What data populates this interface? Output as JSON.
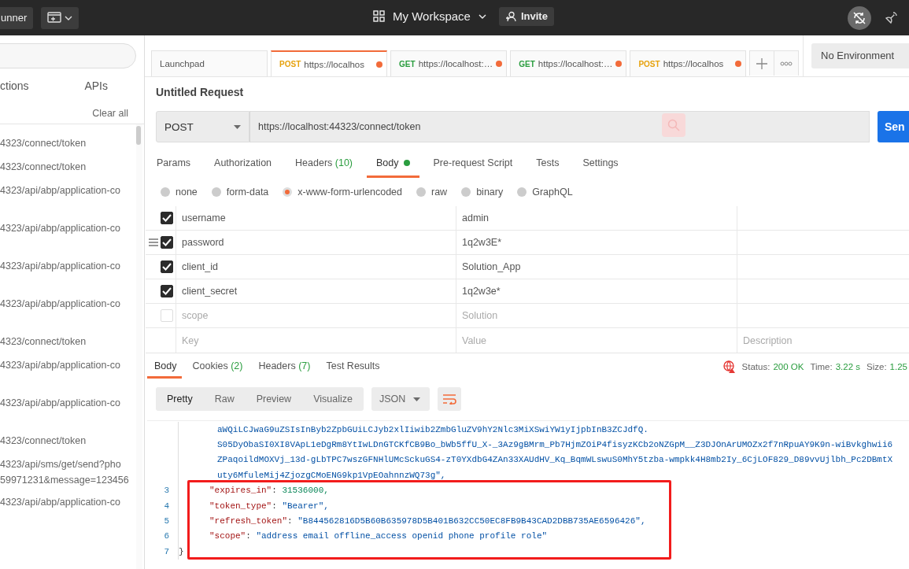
{
  "top_bar": {
    "runner": "unner",
    "workspace": "My Workspace",
    "invite": "Invite"
  },
  "sidebar": {
    "tabs": [
      "ctions",
      "APIs"
    ],
    "clear_all": "Clear all",
    "history": [
      {
        "lines": [
          "4323/connect/token"
        ],
        "tall": false
      },
      {
        "lines": [
          "4323/connect/token"
        ],
        "tall": false
      },
      {
        "lines": [
          "4323/api/abp/application-co"
        ],
        "tall": true
      },
      {
        "lines": [
          "4323/api/abp/application-co"
        ],
        "tall": true
      },
      {
        "lines": [
          "4323/api/abp/application-co"
        ],
        "tall": true
      },
      {
        "lines": [
          "4323/api/abp/application-co"
        ],
        "tall": true
      },
      {
        "lines": [
          "4323/connect/token"
        ],
        "tall": false
      },
      {
        "lines": [
          "4323/api/abp/application-co"
        ],
        "tall": true
      },
      {
        "lines": [
          "4323/api/abp/application-co"
        ],
        "tall": true
      },
      {
        "lines": [
          "4323/connect/token"
        ],
        "tall": false
      },
      {
        "lines": [
          "4323/api/sms/get/send?pho",
          "59971231&message=123456"
        ],
        "tall": true
      },
      {
        "lines": [
          "4323/api/abp/application-co"
        ],
        "tall": true
      }
    ]
  },
  "request_tabs": [
    {
      "label": "Launchpad",
      "selected": false,
      "unsaved": false
    },
    {
      "label": "https://localhos",
      "method": "POST",
      "selected": true,
      "unsaved": true
    },
    {
      "label": "https://localhost:…",
      "method": "GET",
      "selected": false,
      "unsaved": true
    },
    {
      "label": "https://localhost:…",
      "method": "GET",
      "selected": false,
      "unsaved": true
    },
    {
      "label": "https://localhos",
      "method": "POST",
      "selected": false,
      "unsaved": true
    }
  ],
  "environment": "No Environment",
  "request": {
    "title": "Untitled Request",
    "method": "POST",
    "url": "https://localhost:44323/connect/token",
    "send": "Sen"
  },
  "sections": [
    {
      "label": "Params",
      "selected": false,
      "dot": false
    },
    {
      "label": "Authorization",
      "selected": false,
      "dot": false
    },
    {
      "label": "Headers",
      "count": "(10)",
      "selected": false,
      "dot": false
    },
    {
      "label": "Body",
      "selected": true,
      "dot": true
    },
    {
      "label": "Pre-request Script",
      "selected": false,
      "dot": false
    },
    {
      "label": "Tests",
      "selected": false,
      "dot": false
    },
    {
      "label": "Settings",
      "selected": false,
      "dot": false
    }
  ],
  "body_types": [
    {
      "label": "none",
      "selected": false
    },
    {
      "label": "form-data",
      "selected": false
    },
    {
      "label": "x-www-form-urlencoded",
      "selected": true
    },
    {
      "label": "raw",
      "selected": false
    },
    {
      "label": "binary",
      "selected": false
    },
    {
      "label": "GraphQL",
      "selected": false
    }
  ],
  "params": [
    {
      "key": "username",
      "value": "admin",
      "checked": true
    },
    {
      "key": "password",
      "value": "1q2w3E*",
      "checked": true,
      "handle": true
    },
    {
      "key": "client_id",
      "value": "Solution_App",
      "checked": true
    },
    {
      "key": "client_secret",
      "value": "1q2w3e*",
      "checked": true
    },
    {
      "key": "scope",
      "value": "Solution",
      "checked": false
    }
  ],
  "new_param": {
    "key_placeholder": "Key",
    "value_placeholder": "Value",
    "description_placeholder": "Description"
  },
  "response_tabs": [
    {
      "label": "Body",
      "selected": true
    },
    {
      "label": "Cookies",
      "count": "(2)",
      "selected": false
    },
    {
      "label": "Headers",
      "count": "(7)",
      "selected": false
    },
    {
      "label": "Test Results",
      "selected": false
    }
  ],
  "response_meta": [
    {
      "label": "Status:",
      "value": "200 OK"
    },
    {
      "label": "Time:",
      "value": "3.22 s"
    },
    {
      "label": "Size:",
      "value": "1.25"
    }
  ],
  "view_modes": [
    {
      "label": "Pretty",
      "selected": true
    },
    {
      "label": "Raw",
      "selected": false
    },
    {
      "label": "Preview",
      "selected": false
    },
    {
      "label": "Visualize",
      "selected": false
    }
  ],
  "format": "JSON",
  "code_lines": [
    {
      "kind": "continuation",
      "text": "aWQiLCJwaG9uZSIsInByb2ZpbGUiLCJyb2xlIiwib2ZmbGluZV9hY2Nlc3MiXSwiYW1yIjpbInB3ZCJdfQ.",
      "highlighted": false
    },
    {
      "kind": "continuation",
      "text": "S05DyObaSI0XI8VApL1eDgRm8YtIwLDnGTCKfCB9Bo_bWb5ffU_X-_3Az9gBMrm_Pb7HjmZOiP4fisyzKCb2oNZGpM__Z3DJOnArUMOZx2f7nRpuAY9K9n-wiBvkghwii6",
      "highlighted": false
    },
    {
      "kind": "continuation",
      "text": "ZPaqoildMOXVj_13d-gLbTPC7wszGFNHlUMcSckuGS4-zT0YXdbG4ZAn33XAUdHV_Kq_BqmWLswuS0MhY5tzba-wmpkk4H8mb2Iy_6CjLOF829_D89vvUjlbh_Pc2DBmtX",
      "highlighted": false
    },
    {
      "kind": "continuation",
      "text": "uty6MfuleMij4ZjozgCMoENG9kp1VpEOahnnzWQ73g\",",
      "highlighted": false
    },
    {
      "kind": "number",
      "number": "3",
      "key": "\"expires_in\"",
      "separator": ":",
      "value": "31536000,",
      "highlighted": true
    },
    {
      "kind": "string",
      "number": "4",
      "key": "\"token_type\"",
      "separator": ":",
      "value": "\"Bearer\",",
      "highlighted": true
    },
    {
      "kind": "string",
      "number": "5",
      "key": "\"refresh_token\"",
      "separator": ":",
      "value": "\"B844562816D5B60B635978D5B401B632CC50EC8FB9B43CAD2DBB735AE6596426\",",
      "highlighted": true
    },
    {
      "kind": "string",
      "number": "6",
      "key": "\"scope\"",
      "separator": ":",
      "value": "\"address email offline_access openid phone profile role\"",
      "highlighted": true
    },
    {
      "kind": "brace",
      "number": "7",
      "text": "}",
      "highlighted": true
    }
  ]
}
